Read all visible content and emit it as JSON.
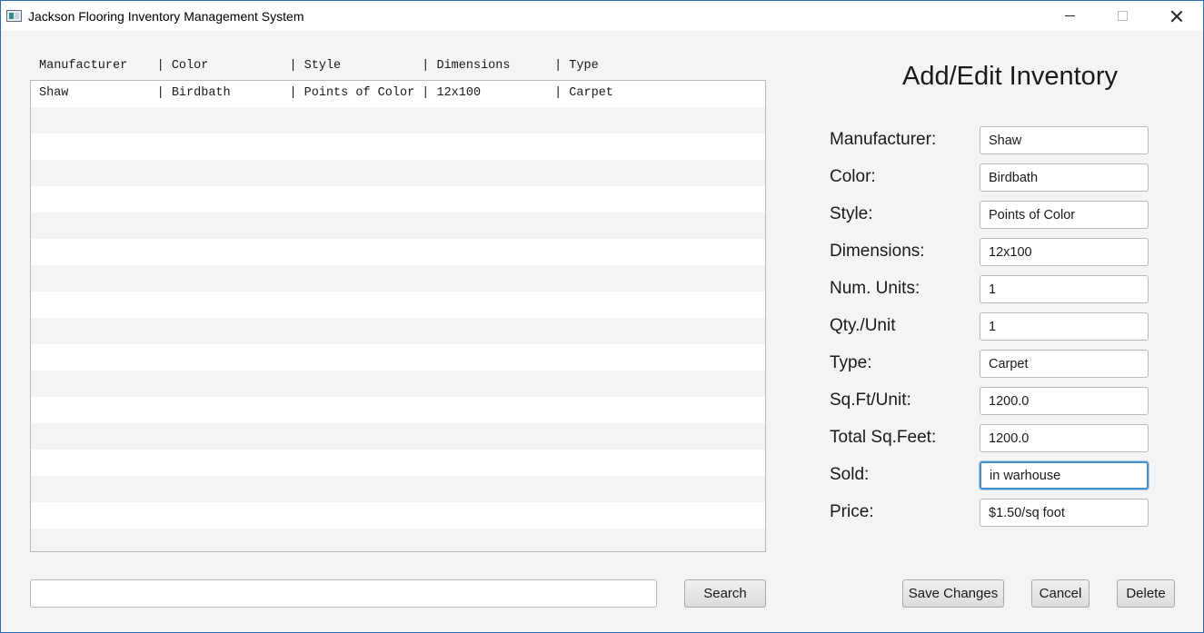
{
  "window": {
    "title": "Jackson Flooring Inventory Management System"
  },
  "list": {
    "header": "Manufacturer    | Color           | Style           | Dimensions      | Type",
    "rows": [
      "Shaw            | Birdbath        | Points of Color | 12x100          | Carpet"
    ]
  },
  "form": {
    "title": "Add/Edit Inventory",
    "fields": [
      {
        "label": "Manufacturer:",
        "value": "Shaw"
      },
      {
        "label": "Color:",
        "value": "Birdbath"
      },
      {
        "label": "Style:",
        "value": "Points of Color"
      },
      {
        "label": "Dimensions:",
        "value": "12x100"
      },
      {
        "label": "Num. Units:",
        "value": "1"
      },
      {
        "label": "Qty./Unit",
        "value": "1"
      },
      {
        "label": "Type:",
        "value": "Carpet"
      },
      {
        "label": "Sq.Ft/Unit:",
        "value": "1200.0"
      },
      {
        "label": "Total Sq.Feet:",
        "value": "1200.0"
      },
      {
        "label": "Sold:",
        "value": "in warhouse"
      },
      {
        "label": "Price:",
        "value": "$1.50/sq foot"
      }
    ]
  },
  "bottom": {
    "search_value": "",
    "search_label": "Search",
    "save_label": "Save Changes",
    "cancel_label": "Cancel",
    "delete_label": "Delete"
  },
  "colors": {
    "window_border": "#2c6cb6",
    "focus_ring": "#4a90c8",
    "background": "#f4f4f4"
  }
}
